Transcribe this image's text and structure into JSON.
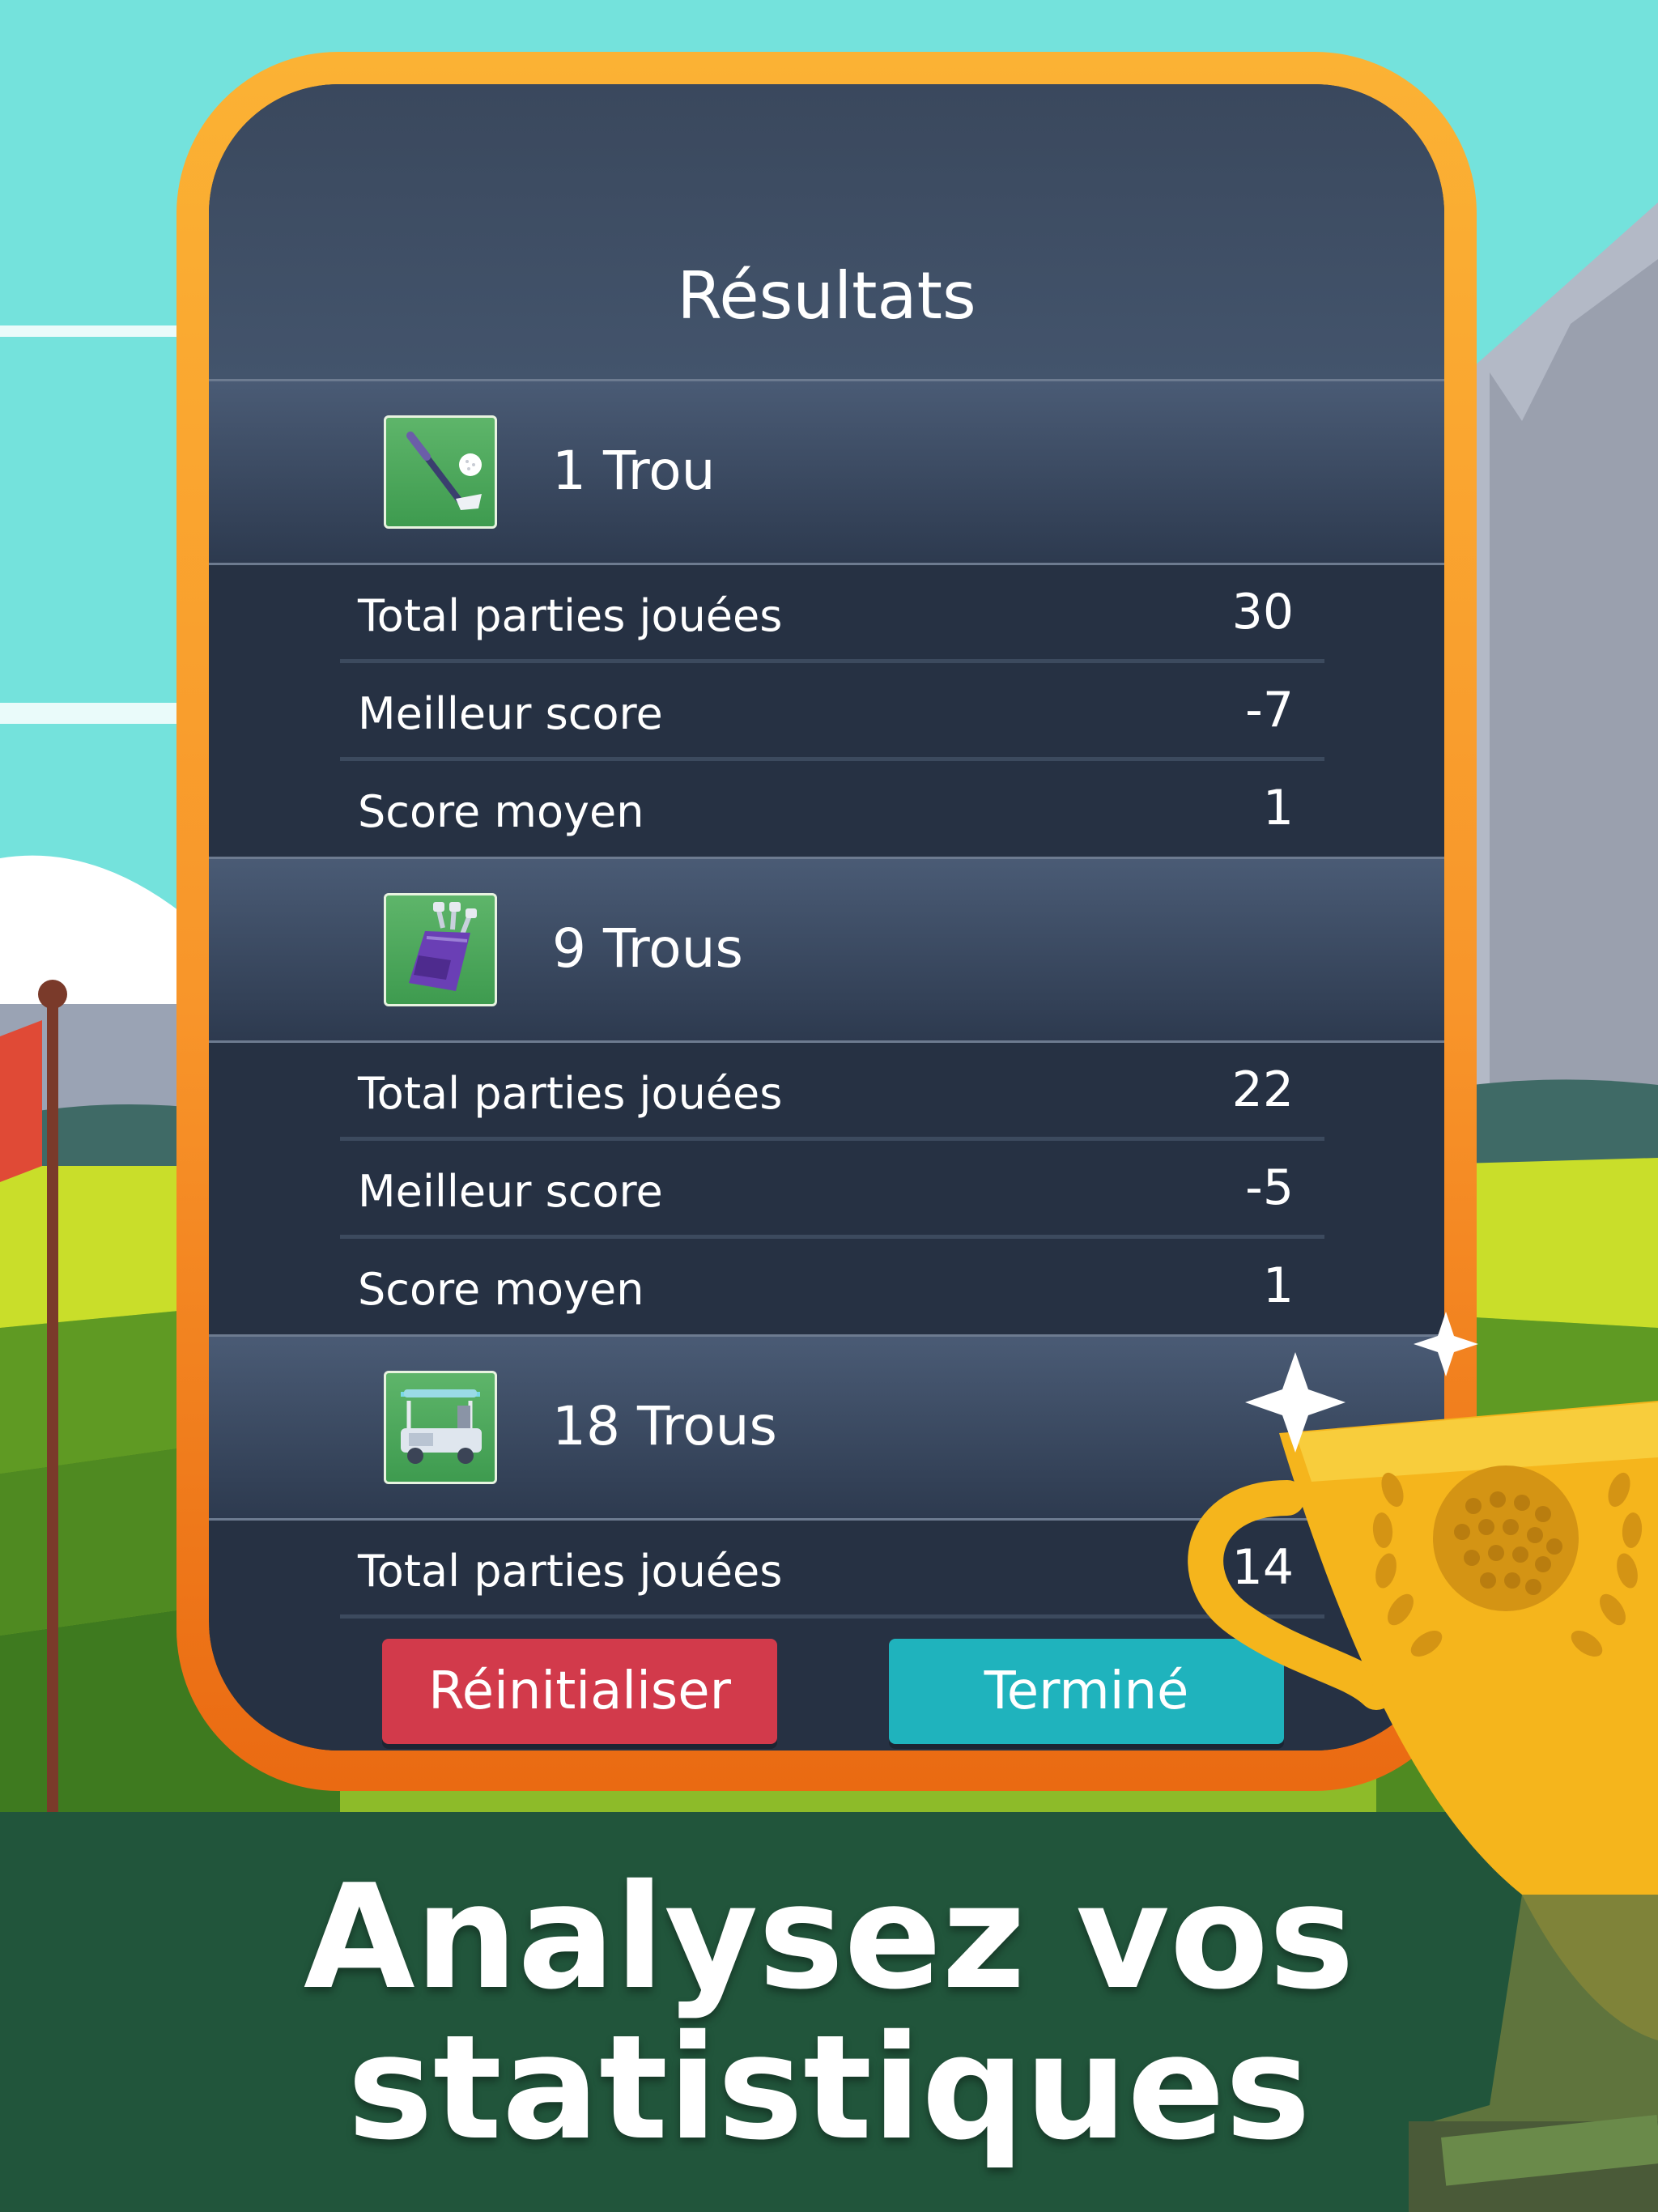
{
  "card": {
    "title": "Résultats",
    "sections": [
      {
        "label": "1 Trou",
        "icon": "golf-club-ball-icon",
        "stats": [
          {
            "label": "Total parties jouées",
            "value": "30"
          },
          {
            "label": "Meilleur score",
            "value": "-7"
          },
          {
            "label": "Score moyen",
            "value": "1"
          }
        ]
      },
      {
        "label": "9 Trous",
        "icon": "golf-bag-icon",
        "stats": [
          {
            "label": "Total parties jouées",
            "value": "22"
          },
          {
            "label": "Meilleur score",
            "value": "-5"
          },
          {
            "label": "Score moyen",
            "value": "1"
          }
        ]
      },
      {
        "label": "18 Trous",
        "icon": "golf-cart-icon",
        "stats": [
          {
            "label": "Total parties jouées",
            "value": "14"
          }
        ]
      }
    ]
  },
  "buttons": {
    "reset_label": "Réinitialiser",
    "done_label": "Terminé"
  },
  "banner": {
    "line1": "Analysez vos",
    "line2": "statistiques"
  },
  "colors": {
    "sky": "#74e2dc",
    "card_border": "#f8952a",
    "card_body": "#263143",
    "reset_button": "#d23a4b",
    "done_button": "#1fb3bd",
    "banner": "#21553b",
    "trophy": "#f5b51c"
  }
}
